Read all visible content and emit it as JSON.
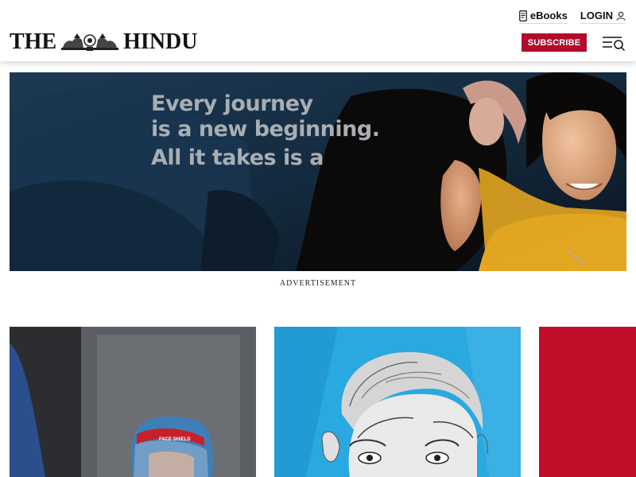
{
  "header": {
    "logo_left": "THE",
    "logo_right": "HINDU",
    "ebooks_label": "eBooks",
    "login_label": "LOGIN",
    "subscribe_label": "SUBSCRIBE",
    "menu_icon": "menu-search-icon"
  },
  "advertisement": {
    "line1": "Every journey",
    "line2": "is a new beginning.",
    "line3": "All it takes is a",
    "caption": "ADVERTISEMENT"
  },
  "cards": [
    {
      "image": "health-worker-face-shield-photo",
      "badge_text": "FACE SHIELD"
    },
    {
      "image": "man-portrait-illustration"
    },
    {
      "image": "red-graphic"
    }
  ],
  "colors": {
    "brand_red": "#b30b2b",
    "card_blue": "#2aa8e0",
    "card_red": "#c20e2a"
  }
}
